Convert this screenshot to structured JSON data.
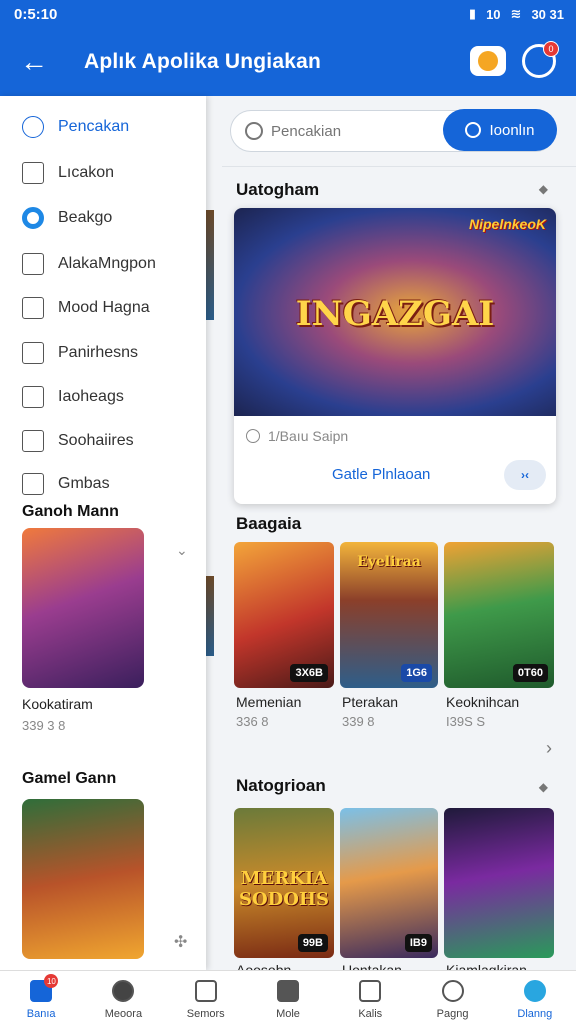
{
  "status": {
    "time": "0:5:10",
    "right_text": "10",
    "battery": "30 31"
  },
  "app": {
    "title": "Aplık Apolika Ungiakan",
    "bell_count": "0"
  },
  "sidebar": {
    "items": [
      {
        "label": "Pencakan",
        "icon": "search-icon"
      },
      {
        "label": "Lıcakon",
        "icon": "home-icon"
      },
      {
        "label": "Beakgo",
        "icon": "circle-icon"
      },
      {
        "label": "AlakaMngpon",
        "icon": "square-icon"
      },
      {
        "label": "Mood Hagna",
        "icon": "folder-icon"
      },
      {
        "label": "Panirhesns",
        "icon": "edit-icon"
      },
      {
        "label": "Iaoheags",
        "icon": "box-icon"
      },
      {
        "label": "Soohaiires",
        "icon": "list-icon"
      },
      {
        "label": "Gmbas",
        "icon": "gamepad-icon"
      }
    ],
    "section1": {
      "heading": "Ganoh Mann",
      "name": "Kookatiram",
      "price": "339 3 8"
    },
    "section2": {
      "heading": "Gamel Gann"
    }
  },
  "search": {
    "placeholder": "Pencakian",
    "button": "Ioonlın"
  },
  "featured": {
    "section_title": "Uatogham",
    "brand": "NipelnkeoK",
    "art_title": "INGAZGAI",
    "meta": "1/Baıu Saipn",
    "cta": "Gatle Plnlaoan",
    "pill": "›‹"
  },
  "row1": {
    "title": "Baagaia",
    "tiles": [
      {
        "name": "Memenian",
        "price": "336 8",
        "badge": "3X6B"
      },
      {
        "name": "Pterakan",
        "price": "339 8",
        "badge": "1G6",
        "label": "Eyeliraa"
      },
      {
        "name": "Keoknihcan",
        "price": "I39S S",
        "badge": "0T60"
      }
    ]
  },
  "row2": {
    "title": "Natogrioan",
    "tiles": [
      {
        "name": "Aoosobn",
        "badge": "99B",
        "label": "MERKIA SODOHS"
      },
      {
        "name": "Uontakan",
        "badge": "IB9"
      },
      {
        "name": "Kiamlagkiran",
        "badge": ""
      }
    ]
  },
  "nav": [
    {
      "label": "Banıa",
      "badge": "10"
    },
    {
      "label": "Meoora"
    },
    {
      "label": "Semors"
    },
    {
      "label": "Mole"
    },
    {
      "label": "Kalis"
    },
    {
      "label": "Pagng"
    },
    {
      "label": "Dlanng"
    }
  ],
  "colors": {
    "primary": "#1565d8",
    "accent": "#29a6e0",
    "badge": "#e53935"
  }
}
